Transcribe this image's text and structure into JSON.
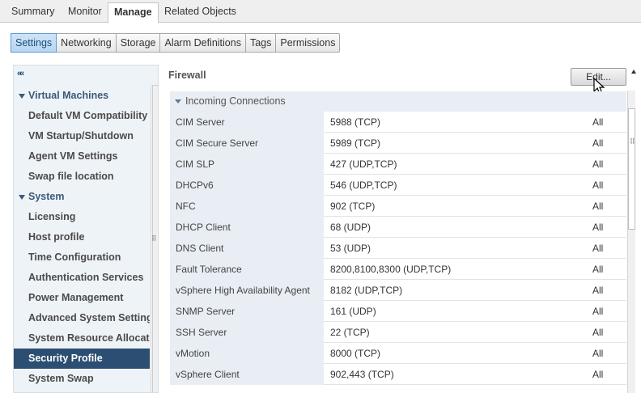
{
  "top_tabs": [
    "Summary",
    "Monitor",
    "Manage",
    "Related Objects"
  ],
  "sub_tabs": [
    "Settings",
    "Networking",
    "Storage",
    "Alarm Definitions",
    "Tags",
    "Permissions"
  ],
  "collapse_icon": "««",
  "nav": [
    {
      "label": "Virtual Machines",
      "type": "group"
    },
    {
      "label": "Default VM Compatibility",
      "type": "child"
    },
    {
      "label": "VM Startup/Shutdown",
      "type": "child"
    },
    {
      "label": "Agent VM Settings",
      "type": "child"
    },
    {
      "label": "Swap file location",
      "type": "child"
    },
    {
      "label": "System",
      "type": "group"
    },
    {
      "label": "Licensing",
      "type": "child"
    },
    {
      "label": "Host profile",
      "type": "child"
    },
    {
      "label": "Time Configuration",
      "type": "child"
    },
    {
      "label": "Authentication Services",
      "type": "child"
    },
    {
      "label": "Power Management",
      "type": "child"
    },
    {
      "label": "Advanced System Settings",
      "type": "child"
    },
    {
      "label": "System Resource Allocation",
      "type": "child"
    },
    {
      "label": "Security Profile",
      "type": "child",
      "selected": true
    },
    {
      "label": "System Swap",
      "type": "child"
    }
  ],
  "firewall": {
    "title": "Firewall",
    "edit_label": "Edit...",
    "section_label": "Incoming Connections",
    "rows": [
      {
        "name": "CIM Server",
        "ports": "5988 (TCP)",
        "direction": "All"
      },
      {
        "name": "CIM Secure Server",
        "ports": "5989 (TCP)",
        "direction": "All"
      },
      {
        "name": "CIM SLP",
        "ports": "427 (UDP,TCP)",
        "direction": "All"
      },
      {
        "name": "DHCPv6",
        "ports": "546 (UDP,TCP)",
        "direction": "All"
      },
      {
        "name": "NFC",
        "ports": "902 (TCP)",
        "direction": "All"
      },
      {
        "name": "DHCP Client",
        "ports": "68 (UDP)",
        "direction": "All"
      },
      {
        "name": "DNS Client",
        "ports": "53 (UDP)",
        "direction": "All"
      },
      {
        "name": "Fault Tolerance",
        "ports": "8200,8100,8300 (UDP,TCP)",
        "direction": "All"
      },
      {
        "name": "vSphere High Availability Agent",
        "ports": "8182 (UDP,TCP)",
        "direction": "All"
      },
      {
        "name": "SNMP Server",
        "ports": "161 (UDP)",
        "direction": "All"
      },
      {
        "name": "SSH Server",
        "ports": "22 (TCP)",
        "direction": "All"
      },
      {
        "name": "vMotion",
        "ports": "8000 (TCP)",
        "direction": "All"
      },
      {
        "name": "vSphere Client",
        "ports": "902,443 (TCP)",
        "direction": "All"
      }
    ]
  },
  "colors": {
    "selected_bg": "#2c4e72",
    "panel_bg": "#eef3f8",
    "active_subtab": "#b8d6f2"
  }
}
